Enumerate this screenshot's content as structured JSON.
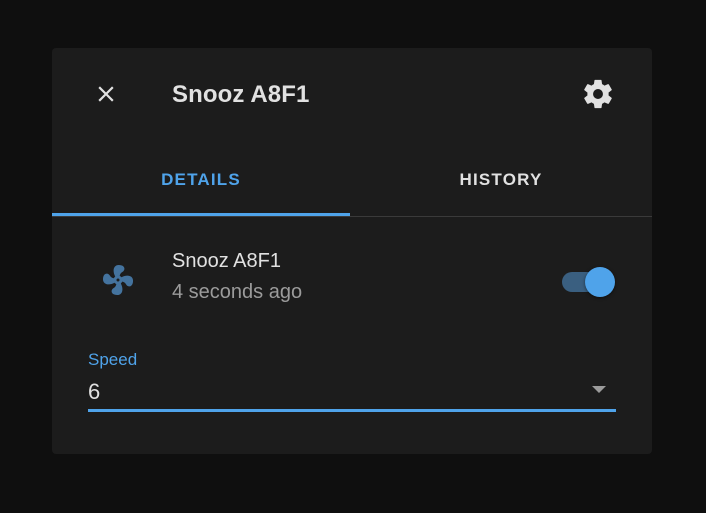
{
  "dialog": {
    "title": "Snooz A8F1",
    "close_icon": "close-icon",
    "settings_icon": "gear-icon"
  },
  "tabs": [
    {
      "label": "DETAILS",
      "active": true
    },
    {
      "label": "HISTORY",
      "active": false
    }
  ],
  "entity": {
    "icon": "fan-icon",
    "name": "Snooz A8F1",
    "last_changed": "4 seconds ago",
    "state_on": true
  },
  "speed": {
    "label": "Speed",
    "value": "6"
  },
  "colors": {
    "accent": "#4fa3ea",
    "dialog_bg": "#1c1c1c",
    "backdrop": "#0f0f0f",
    "text_primary": "#e1e1e1",
    "text_secondary": "#9b9b9b",
    "fan_icon": "#44739e"
  }
}
